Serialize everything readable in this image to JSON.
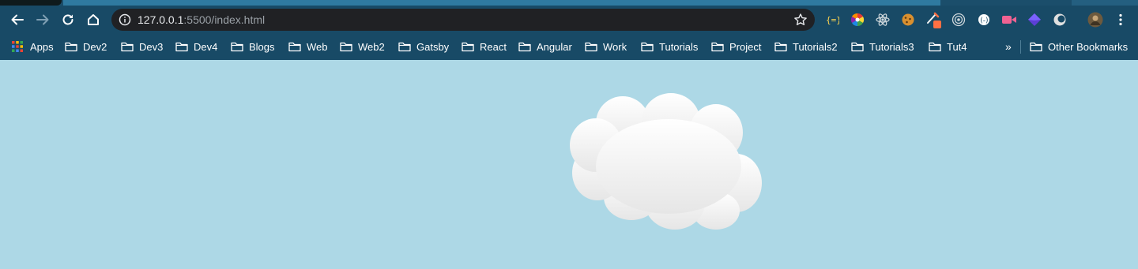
{
  "browser": {
    "url_host": "127.0.0.1",
    "url_rest": ":5500/index.html"
  },
  "bookmarks": [
    {
      "label": "Apps",
      "icon": "apps-grid-icon"
    },
    {
      "label": "Dev2",
      "icon": "folder-icon"
    },
    {
      "label": "Dev3",
      "icon": "folder-icon"
    },
    {
      "label": "Dev4",
      "icon": "folder-icon"
    },
    {
      "label": "Blogs",
      "icon": "folder-icon"
    },
    {
      "label": "Web",
      "icon": "folder-icon"
    },
    {
      "label": "Web2",
      "icon": "folder-icon"
    },
    {
      "label": "Gatsby",
      "icon": "folder-icon"
    },
    {
      "label": "React",
      "icon": "folder-icon"
    },
    {
      "label": "Angular",
      "icon": "folder-icon"
    },
    {
      "label": "Work",
      "icon": "folder-icon"
    },
    {
      "label": "Tutorials",
      "icon": "folder-icon"
    },
    {
      "label": "Project",
      "icon": "folder-icon"
    },
    {
      "label": "Tutorials2",
      "icon": "folder-icon"
    },
    {
      "label": "Tutorials3",
      "icon": "folder-icon"
    },
    {
      "label": "Tut4",
      "icon": "folder-icon"
    }
  ],
  "overflow_label": "»",
  "other_bookmarks": "Other Bookmarks",
  "colors": {
    "chrome": "#184a66",
    "page_background": "#add8e6",
    "cloud_top": "#ffffff",
    "cloud_bottom": "#e6e6e6"
  }
}
